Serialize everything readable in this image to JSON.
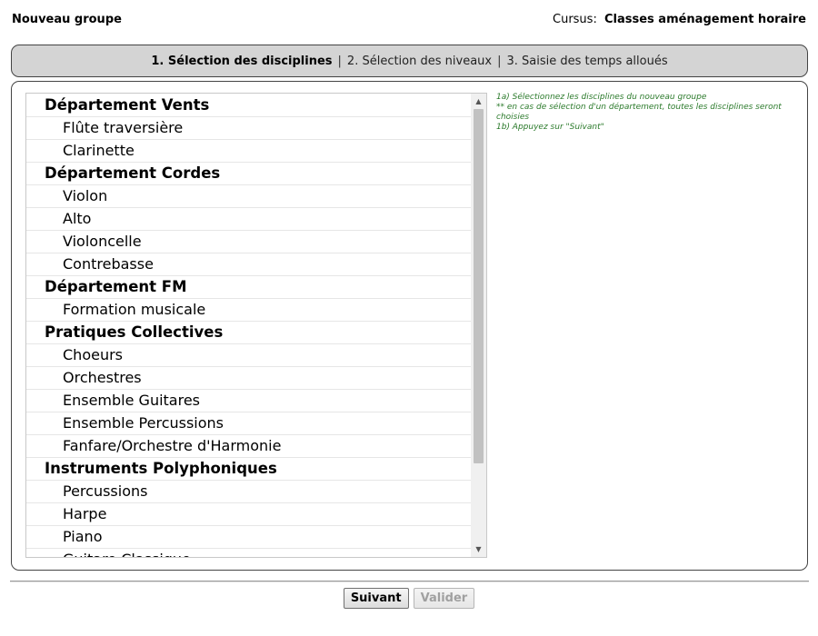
{
  "header": {
    "title": "Nouveau groupe",
    "cursus_label": "Cursus:",
    "cursus_value": "Classes aménagement horaire"
  },
  "steps": {
    "step1": "1. Sélection des disciplines",
    "step2": "2. Sélection des niveaux",
    "step3": "3. Saisie des temps alloués",
    "separator": "|"
  },
  "list": {
    "rows": [
      {
        "type": "dept",
        "label": "Département Vents"
      },
      {
        "type": "item",
        "label": "Flûte traversière"
      },
      {
        "type": "item",
        "label": "Clarinette"
      },
      {
        "type": "dept",
        "label": "Département Cordes"
      },
      {
        "type": "item",
        "label": "Violon"
      },
      {
        "type": "item",
        "label": "Alto"
      },
      {
        "type": "item",
        "label": "Violoncelle"
      },
      {
        "type": "item",
        "label": "Contrebasse"
      },
      {
        "type": "dept",
        "label": "Département FM"
      },
      {
        "type": "item",
        "label": "Formation musicale"
      },
      {
        "type": "dept",
        "label": "Pratiques Collectives"
      },
      {
        "type": "item",
        "label": "Choeurs"
      },
      {
        "type": "item",
        "label": "Orchestres"
      },
      {
        "type": "item",
        "label": "Ensemble Guitares"
      },
      {
        "type": "item",
        "label": "Ensemble Percussions"
      },
      {
        "type": "item",
        "label": "Fanfare/Orchestre d'Harmonie"
      },
      {
        "type": "dept",
        "label": "Instruments Polyphoniques"
      },
      {
        "type": "item",
        "label": "Percussions"
      },
      {
        "type": "item",
        "label": "Harpe"
      },
      {
        "type": "item",
        "label": "Piano"
      },
      {
        "type": "item",
        "label": "Guitare Classique"
      }
    ]
  },
  "help": {
    "line1": "1a) Sélectionnez les disciplines du nouveau groupe",
    "line2": "** en cas de sélection d'un département, toutes les disciplines seront choisies",
    "line3": "1b) Appuyez sur \"Suivant\""
  },
  "buttons": {
    "next": "Suivant",
    "validate": "Valider"
  },
  "icons": {
    "scroll_up": "triangle-up",
    "scroll_down": "triangle-down"
  },
  "colors": {
    "help_text": "#2b7a2b",
    "steps_bg": "#d4d4d4"
  }
}
